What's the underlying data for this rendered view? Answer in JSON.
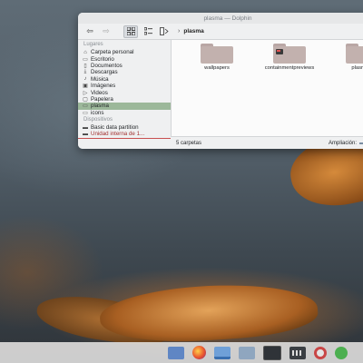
{
  "window": {
    "title": "plasma — Dolphin"
  },
  "toolbar": {
    "back_icon": "arrow-left-icon",
    "forward_icon": "arrow-right-icon",
    "breadcrumb": [
      "plasma"
    ]
  },
  "places": {
    "section_places": "Lugares",
    "section_devices": "Dispositivos",
    "items": [
      {
        "label": "Carpeta personal",
        "icon": "home-icon"
      },
      {
        "label": "Escritorio",
        "icon": "desktop-icon"
      },
      {
        "label": "Documentos",
        "icon": "documents-icon"
      },
      {
        "label": "Descargas",
        "icon": "download-icon"
      },
      {
        "label": "Música",
        "icon": "music-icon"
      },
      {
        "label": "Imágenes",
        "icon": "image-icon"
      },
      {
        "label": "Videos",
        "icon": "video-icon"
      },
      {
        "label": "Papelera",
        "icon": "trash-icon"
      },
      {
        "label": "plasma",
        "icon": "folder-icon"
      },
      {
        "label": "icons",
        "icon": "folder-icon"
      }
    ],
    "devices": [
      {
        "label": "Basic data partition",
        "icon": "drive-icon"
      },
      {
        "label": "Unidad interna de 1...",
        "icon": "drive-icon"
      }
    ]
  },
  "content": {
    "items": [
      {
        "label": "wallpapers"
      },
      {
        "label": "containmentpreviews"
      },
      {
        "label": "plasmoid"
      }
    ]
  },
  "status": {
    "count": "5 carpetas",
    "zoom_label": "Ampliación:"
  },
  "colors": {
    "selected_row": "#9cb89a",
    "folder": "#c2b1ae"
  }
}
